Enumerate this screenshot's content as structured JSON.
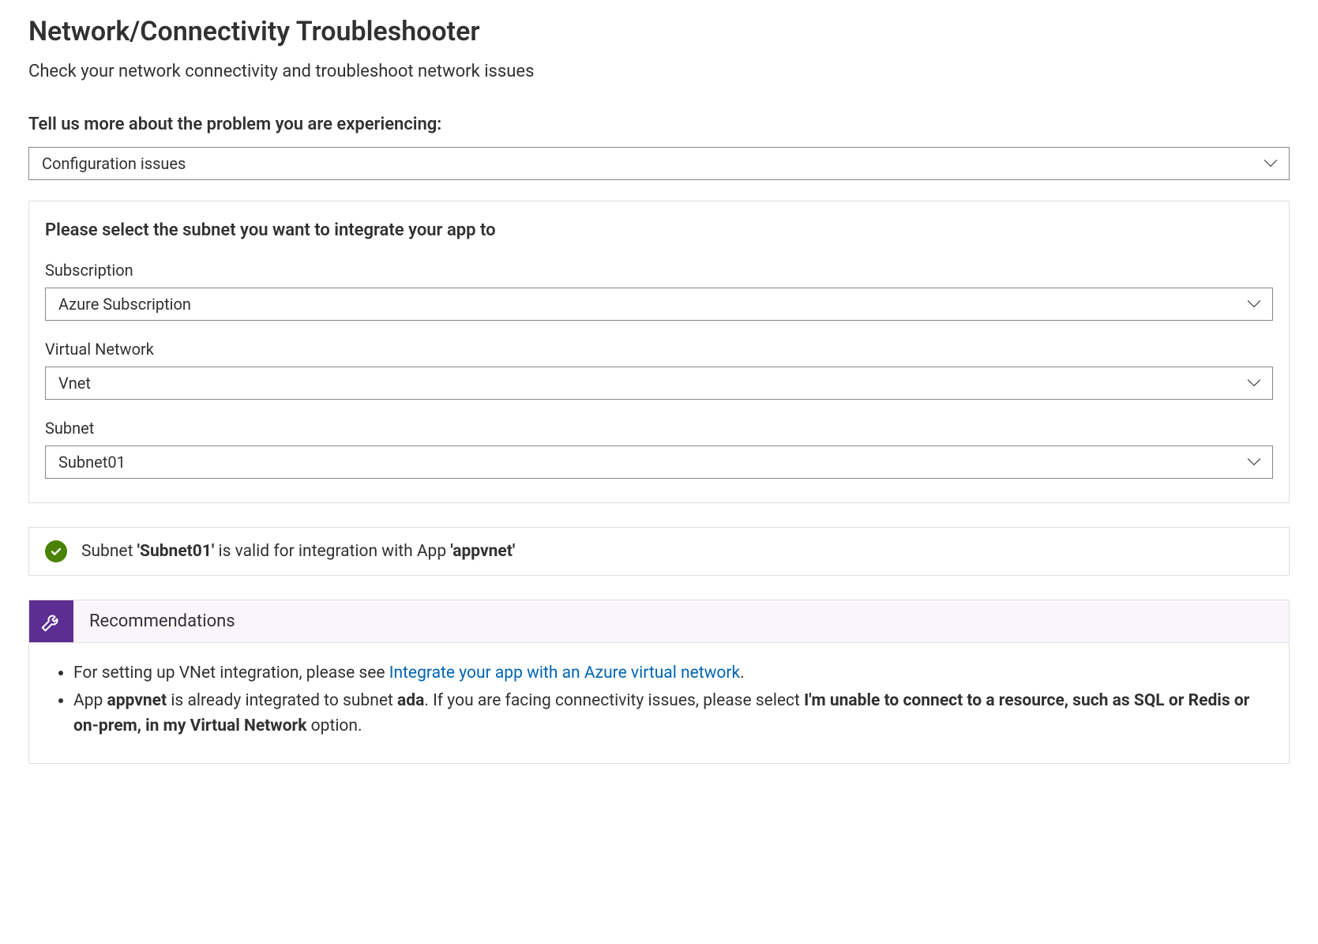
{
  "header": {
    "title": "Network/Connectivity Troubleshooter",
    "subtitle": "Check your network connectivity and troubleshoot network issues"
  },
  "problem": {
    "prompt": "Tell us more about the problem you are experiencing:",
    "selected": "Configuration issues"
  },
  "subnet_card": {
    "heading": "Please select the subnet you want to integrate your app to",
    "fields": {
      "subscription": {
        "label": "Subscription",
        "value": "Azure Subscription"
      },
      "vnet": {
        "label": "Virtual Network",
        "value": "Vnet"
      },
      "subnet": {
        "label": "Subnet",
        "value": "Subnet01"
      }
    }
  },
  "status": {
    "prefix": "Subnet ",
    "subnet_name": "'Subnet01'",
    "middle": " is valid for integration with App ",
    "app_name": "'appvnet'"
  },
  "recommendations": {
    "title": "Recommendations",
    "item1": {
      "prefix": "For setting up VNet integration, please see ",
      "link_text": "Integrate your app with an Azure virtual network",
      "suffix": "."
    },
    "item2": {
      "t1": "App ",
      "app": "appvnet",
      "t2": " is already integrated to subnet ",
      "subnet": "ada",
      "t3": ". If you are facing connectivity issues, please select ",
      "bold_option": "I'm unable to connect to a resource, such as SQL or Redis or on-prem, in my Virtual Network",
      "t4": " option."
    }
  }
}
